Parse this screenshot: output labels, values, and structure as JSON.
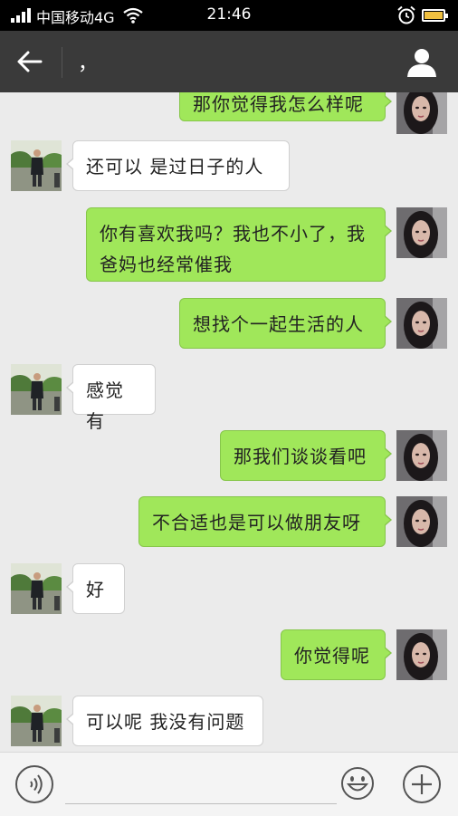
{
  "status_bar": {
    "carrier": "中国移动4G",
    "time": "21:46"
  },
  "header": {
    "title": "，"
  },
  "messages": [
    {
      "side": "right",
      "text": "那你觉得我怎么样呢"
    },
    {
      "side": "left",
      "text": "还可以 是过日子的人"
    },
    {
      "side": "right",
      "text": "你有喜欢我吗？我也不小了，我爸妈也经常催我"
    },
    {
      "side": "right",
      "text": "想找个一起生活的人"
    },
    {
      "side": "left",
      "text": "感觉有"
    },
    {
      "side": "right",
      "text": "那我们谈谈看吧"
    },
    {
      "side": "right",
      "text": "不合适也是可以做朋友呀"
    },
    {
      "side": "left",
      "text": "好"
    },
    {
      "side": "right",
      "text": "你觉得呢"
    },
    {
      "side": "left",
      "text": "可以呢 我没有问题"
    }
  ],
  "colors": {
    "outgoing_bubble": "#a0e75a",
    "incoming_bubble": "#ffffff",
    "title_bar": "#3a3a3a"
  },
  "icons": [
    "signal-icon",
    "wifi-icon",
    "alarm-icon",
    "battery-icon",
    "back-arrow-icon",
    "profile-icon",
    "voice-icon",
    "emoji-icon",
    "plus-icon"
  ]
}
